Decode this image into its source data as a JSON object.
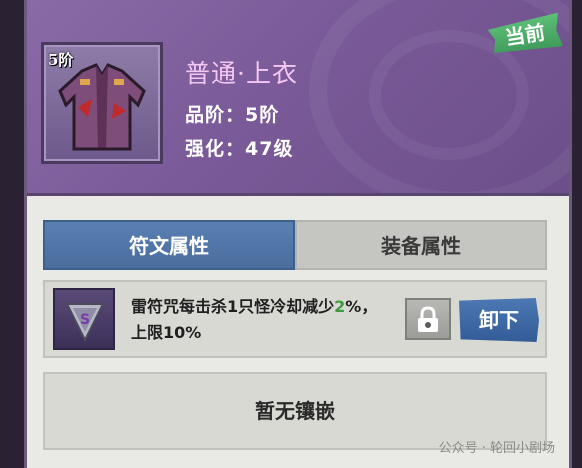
{
  "item": {
    "tier_badge": "5阶",
    "name": "普通·上衣",
    "rank": "品阶：5阶",
    "level": "强化：47级",
    "current_label": "当前"
  },
  "tabs": [
    {
      "label": "符文属性",
      "active": true
    },
    {
      "label": "装备属性",
      "active": false
    }
  ],
  "rune": {
    "desc_main": "雷符咒每击杀1只怪冷却减少",
    "desc_value": "2",
    "desc_tail": "%，上限10%",
    "unload_label": "卸下"
  },
  "empty_slot": {
    "label": "暂无镶嵌"
  },
  "watermark": "公众号 · 轮回小剧场",
  "colors": {
    "accent_blue": "#4a6d9e",
    "header_purple": "#7a5a98",
    "current_green": "#3e9a5a",
    "highlight_green": "#3e9a3e",
    "item_name_pink": "#f4c7f2"
  },
  "icons": {
    "item": "jacket-icon",
    "rune": "rune-gem-icon",
    "lock": "lock-icon"
  }
}
